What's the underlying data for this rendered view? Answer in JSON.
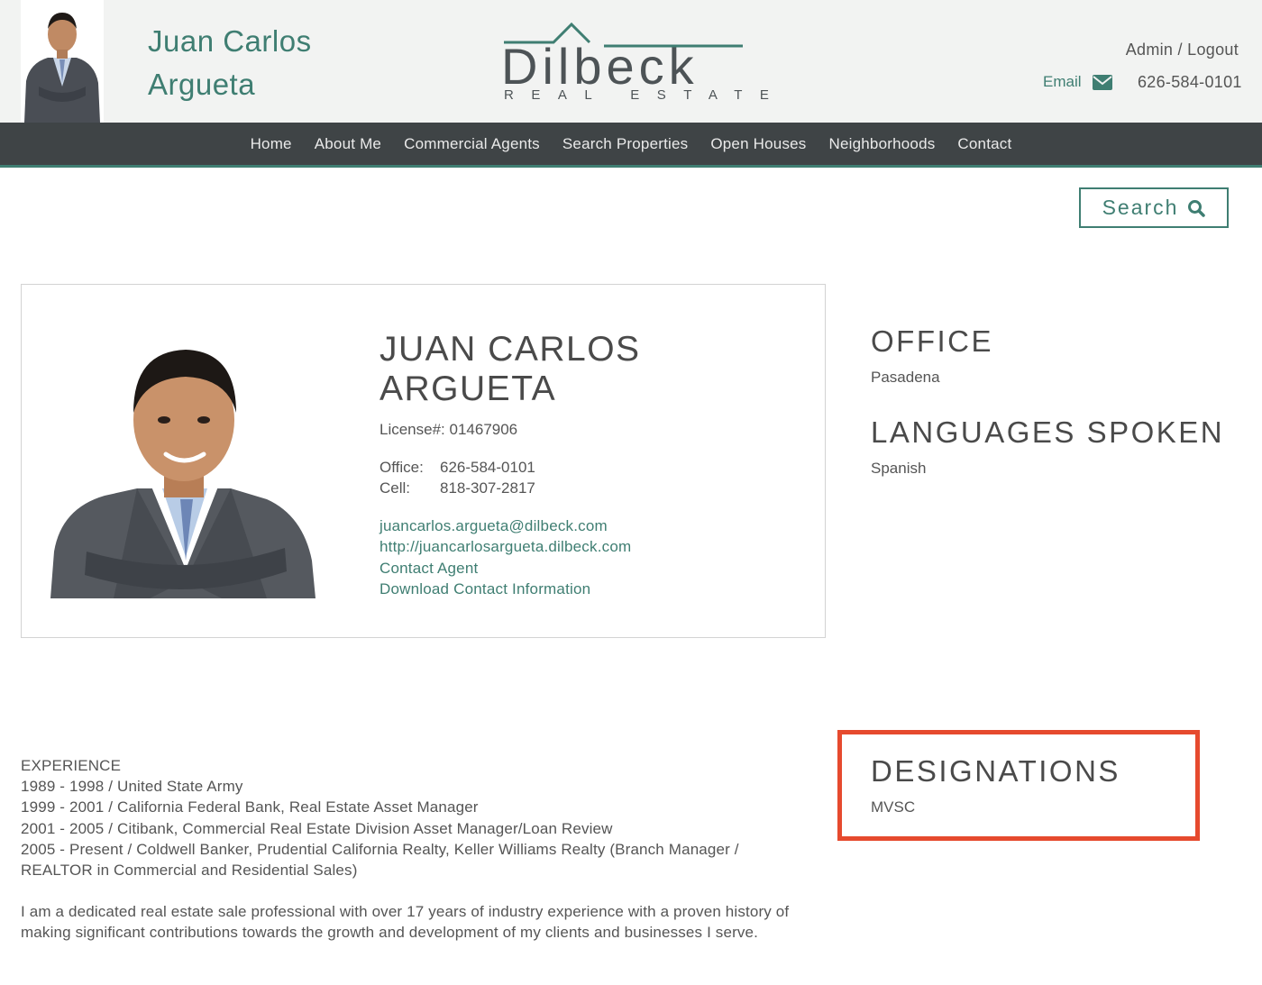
{
  "header": {
    "agent_name_line1": "Juan Carlos",
    "agent_name_line2": "Argueta",
    "logo_word": "Dilbeck",
    "logo_sub": "REAL ESTATE",
    "admin_link": "Admin / Logout",
    "email_label": "Email",
    "phone": "626-584-0101"
  },
  "nav": {
    "items": [
      "Home",
      "About Me",
      "Commercial Agents",
      "Search Properties",
      "Open Houses",
      "Neighborhoods",
      "Contact"
    ]
  },
  "search": {
    "label": "Search"
  },
  "profile": {
    "name_line1": "JUAN CARLOS",
    "name_line2": "ARGUETA",
    "license": "License#: 01467906",
    "office_label": "Office:",
    "office_phone": "626-584-0101",
    "cell_label": "Cell:",
    "cell_phone": "818-307-2817",
    "email": "juancarlos.argueta@dilbeck.com",
    "website": "http://juancarlosargueta.dilbeck.com",
    "contact_agent": "Contact Agent",
    "download_contact": "Download Contact Information"
  },
  "sidebar": {
    "office_heading": "OFFICE",
    "office_value": "Pasadena",
    "languages_heading": "LANGUAGES SPOKEN",
    "languages_value": "Spanish",
    "designations_heading": "DESIGNATIONS",
    "designations_value": "MVSC"
  },
  "bio": {
    "experience_heading": "EXPERIENCE",
    "lines": [
      "1989 - 1998 / United State Army",
      "1999 - 2001 / California Federal Bank, Real Estate Asset Manager",
      "2001 - 2005 / Citibank, Commercial Real Estate Division Asset Manager/Loan Review",
      "2005 - Present / Coldwell Banker, Prudential California Realty, Keller Williams Realty (Branch Manager / REALTOR in Commercial and Residential Sales)"
    ],
    "paragraph": "I am a dedicated real estate sale professional with over 17 years of industry experience with a proven history of making significant contributions towards the growth and development of my clients and businesses I serve."
  },
  "colors": {
    "accent": "#3f7e72",
    "nav_bg": "#3f4446",
    "header_bg": "#f2f3f2",
    "highlight": "#e64a2e"
  }
}
